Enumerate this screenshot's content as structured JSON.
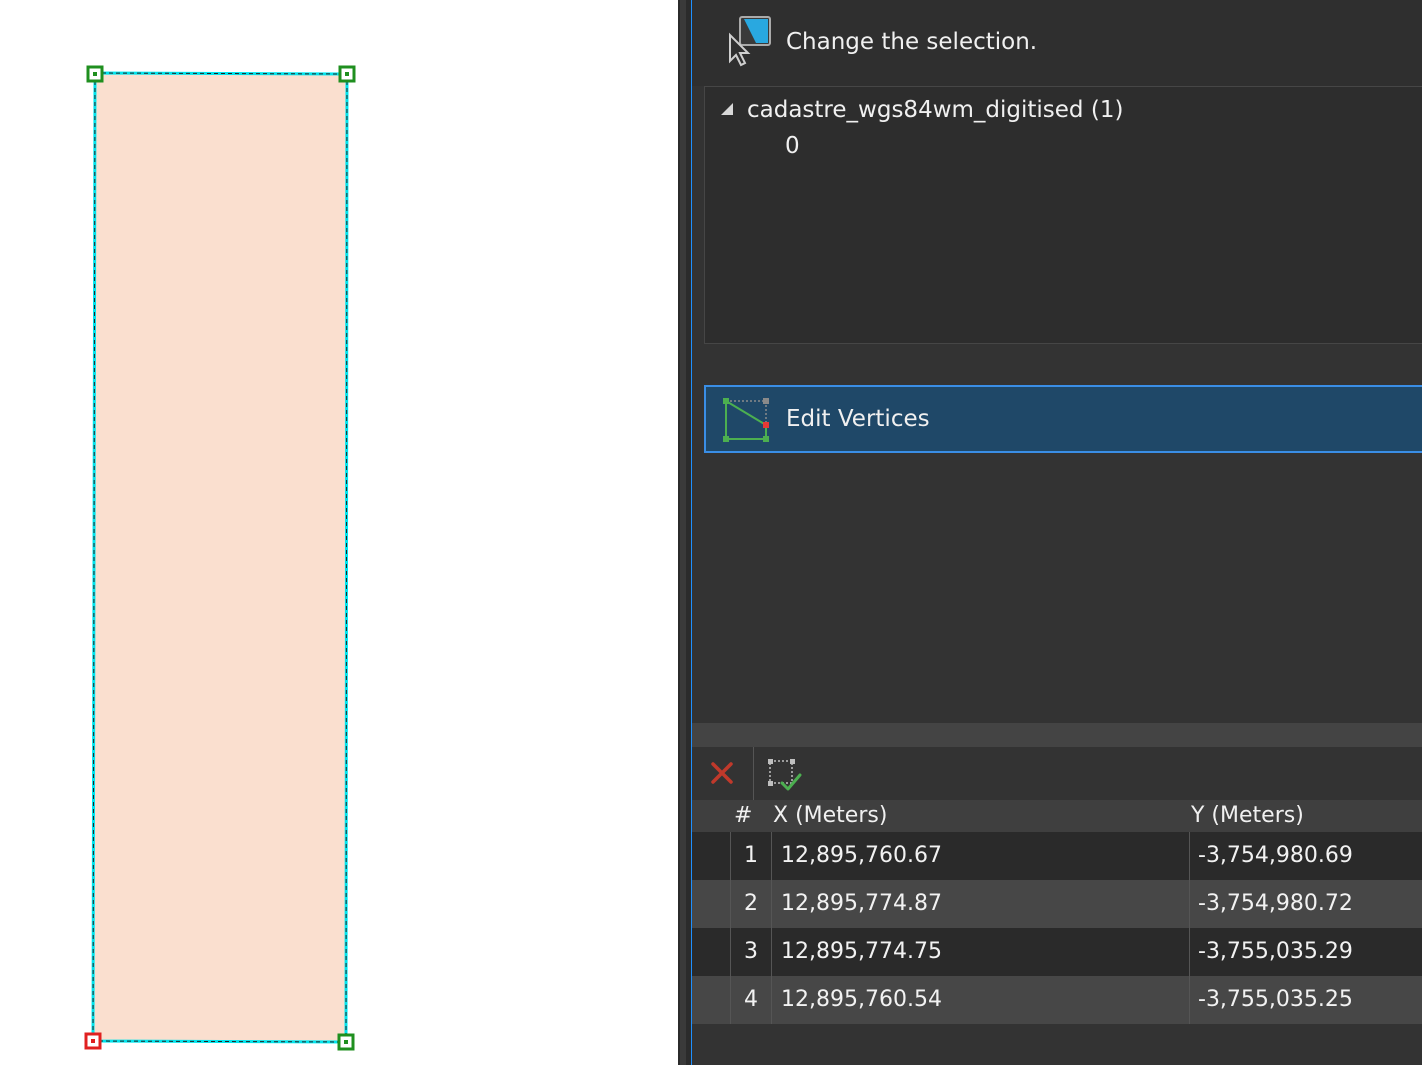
{
  "instruction": {
    "text": "Change the selection.",
    "icon": "pointer-select-icon"
  },
  "selection_tree": {
    "layer_label": "cadastre_wgs84wm_digitised (1)",
    "features": [
      "0"
    ]
  },
  "tools": {
    "edit_vertices": {
      "label": "Edit Vertices",
      "icon": "edit-vertices-icon",
      "selected": true
    }
  },
  "vertex_toolbar": {
    "delete": {
      "icon": "delete-x-icon",
      "color": "#c0392b"
    },
    "finish": {
      "icon": "finish-sketch-icon",
      "color": "#4caf50"
    }
  },
  "vertex_table": {
    "columns": {
      "index": "#",
      "x": "X (Meters)",
      "y": "Y (Meters)"
    },
    "rows": [
      {
        "n": "1",
        "x": "12,895,760.67",
        "y": "-3,754,980.69"
      },
      {
        "n": "2",
        "x": "12,895,774.87",
        "y": "-3,754,980.72"
      },
      {
        "n": "3",
        "x": "12,895,774.75",
        "y": "-3,755,035.29"
      },
      {
        "n": "4",
        "x": "12,895,760.54",
        "y": "-3,755,035.25"
      }
    ]
  },
  "map": {
    "polygon_fill": "#fadfcf",
    "selection_outline": "#00e5ee",
    "vertex_color": "#1f8f1f",
    "active_vertex_color": "#e02020"
  }
}
